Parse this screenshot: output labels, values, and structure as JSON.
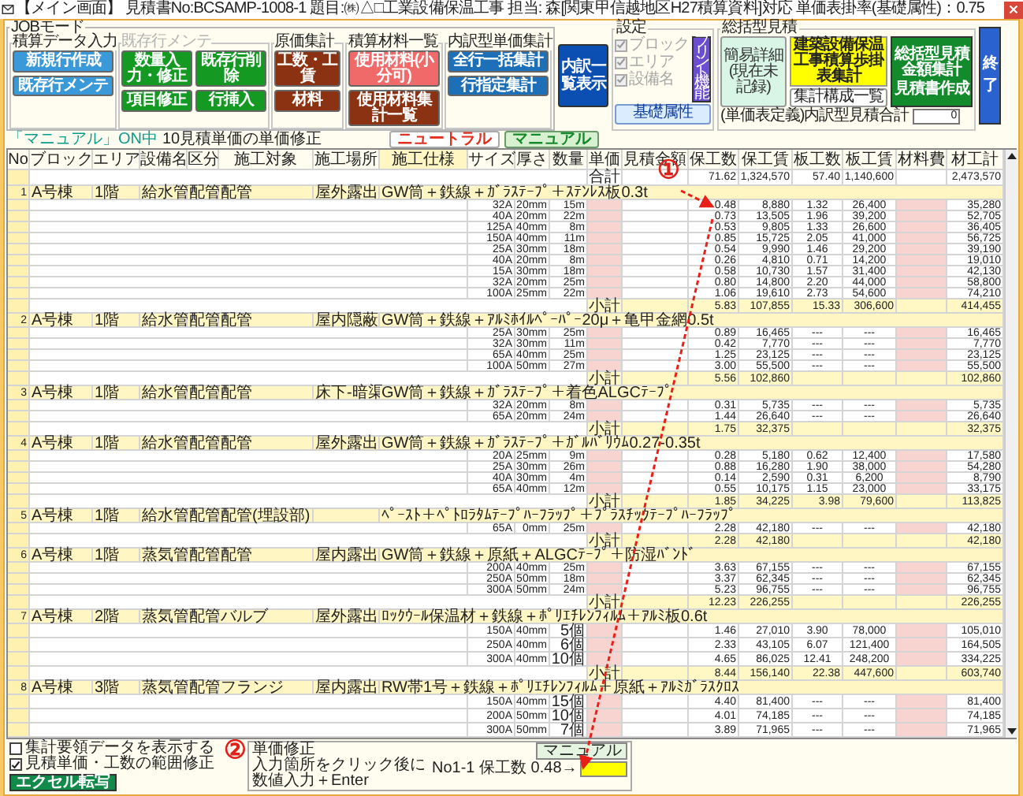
{
  "window": {
    "title": "【メイン画面】 見積書No:BCSAMP-1008-1 題目:㈱△□工業設備保温工事 担当: 森[関東甲信越地区H27積算資料]対応 単価表掛率(基礎属性)：0.75"
  },
  "toolbar": {
    "job_mode_label": "JOBモード",
    "groups": [
      {
        "label": "積算データ入力",
        "disabled": false,
        "buttons": [
          {
            "label": "新規行作成",
            "color": "#3a9ad9"
          },
          {
            "label": "既存行メンテ",
            "color": "#3a9ad9"
          }
        ]
      },
      {
        "label": "既存行メンテ",
        "disabled": true,
        "buttons": [
          {
            "label": "数量入力・修正",
            "color": "#149a22"
          },
          {
            "label": "既存行削除",
            "color": "#149a22"
          },
          {
            "label": "項目修正",
            "color": "#149a22"
          },
          {
            "label": "行挿入",
            "color": "#149a22"
          }
        ]
      },
      {
        "label": "原価集計",
        "disabled": false,
        "buttons": [
          {
            "label": "工数・工賃",
            "color": "#8a3212"
          },
          {
            "label": "材料",
            "color": "#8a3212"
          }
        ]
      },
      {
        "label": "積算材料一覧",
        "disabled": false,
        "buttons": [
          {
            "label": "使用材料(小分可)",
            "color": "#f06a6a"
          },
          {
            "label": "使用材料集計一覧",
            "color": "#8a3212"
          }
        ]
      },
      {
        "label": "内訳型単価集計",
        "disabled": false,
        "buttons": [
          {
            "label": "全行一括集計",
            "color": "#1d6fb8"
          },
          {
            "label": "行指定集計",
            "color": "#1d6fb8"
          }
        ]
      }
    ],
    "list_button": {
      "label": "内訳一覧表示",
      "color": "#0b4fb2"
    },
    "settings": {
      "label": "設定",
      "options": [
        {
          "label": "ブロック",
          "checked": true,
          "disabled": true
        },
        {
          "label": "エリア",
          "checked": true,
          "disabled": true
        },
        {
          "label": "設備名",
          "checked": true,
          "disabled": true
        }
      ],
      "print_button": "プリント機能",
      "base_button": "基礎属性"
    },
    "summary": {
      "label": "総括型見積",
      "simple_button": "簡易詳細(現在未記録)",
      "tally_button": "建築設備保温工事積算歩掛表集計",
      "structure_button": "集計構成一覧",
      "estimate_button": {
        "label": "総括型見積金額集計",
        "sublabel": "見積書作成"
      },
      "total_label": "(単価表定義)内訳型見積合計",
      "total_value": "0"
    },
    "exit_button": "終了"
  },
  "mode_bar": {
    "mode": "「マニュアル」ON中",
    "note": "10見積単価の単価修正",
    "buttons": [
      {
        "label": "ニュートラル",
        "selected": false
      },
      {
        "label": "マニュアル",
        "selected": true
      }
    ]
  },
  "table": {
    "callout": "①",
    "columns": [
      "No",
      "ブロック",
      "エリア",
      "設備名",
      "区分",
      "施工対象",
      "施工場所",
      "施工仕様",
      "サイズ",
      "厚さ",
      "数量",
      "単価",
      "見積金額",
      "保工数",
      "保工賃",
      "板工数",
      "板工賃",
      "材料費",
      "材工計"
    ],
    "rows": [
      {
        "kind": "total",
        "label": "合計",
        "labor_hours": "71.62",
        "labor_cost": "1,324,570",
        "sheet_hours": "57.40",
        "sheet_cost": "1,140,600",
        "total": "2,473,570"
      },
      {
        "kind": "section",
        "no": "1",
        "block": "A号棟",
        "area": "1階",
        "equipment": "給水管",
        "category": "配管",
        "target": "配管",
        "place": "屋外露出",
        "spec": "GW筒＋鉄線＋ｶﾞﾗｽﾃｰﾌﾟ＋ｽﾃﾝﾚｽ板0.3t"
      },
      {
        "kind": "item",
        "size": "32A",
        "thickness": "20mm",
        "qty": "15m",
        "labor_hours": "0.48",
        "labor_cost": "8,880",
        "sheet_hours": "1.32",
        "sheet_cost": "26,400",
        "total": "35,280"
      },
      {
        "kind": "item",
        "size": "40A",
        "thickness": "20mm",
        "qty": "22m",
        "labor_hours": "0.73",
        "labor_cost": "13,505",
        "sheet_hours": "1.96",
        "sheet_cost": "39,200",
        "total": "52,705"
      },
      {
        "kind": "item",
        "size": "125A",
        "thickness": "40mm",
        "qty": "8m",
        "labor_hours": "0.53",
        "labor_cost": "9,805",
        "sheet_hours": "1.33",
        "sheet_cost": "26,600",
        "total": "36,405"
      },
      {
        "kind": "item",
        "size": "150A",
        "thickness": "40mm",
        "qty": "11m",
        "labor_hours": "0.85",
        "labor_cost": "15,725",
        "sheet_hours": "2.05",
        "sheet_cost": "41,000",
        "total": "56,725"
      },
      {
        "kind": "item",
        "size": "25A",
        "thickness": "30mm",
        "qty": "18m",
        "labor_hours": "0.54",
        "labor_cost": "9,990",
        "sheet_hours": "1.46",
        "sheet_cost": "29,200",
        "total": "39,190"
      },
      {
        "kind": "item",
        "size": "40A",
        "thickness": "20mm",
        "qty": "8m",
        "labor_hours": "0.26",
        "labor_cost": "4,810",
        "sheet_hours": "0.71",
        "sheet_cost": "14,200",
        "total": "19,010"
      },
      {
        "kind": "item",
        "size": "15A",
        "thickness": "30mm",
        "qty": "18m",
        "labor_hours": "0.58",
        "labor_cost": "10,730",
        "sheet_hours": "1.57",
        "sheet_cost": "31,400",
        "total": "42,130"
      },
      {
        "kind": "item",
        "size": "32A",
        "thickness": "20mm",
        "qty": "25m",
        "labor_hours": "0.80",
        "labor_cost": "14,800",
        "sheet_hours": "2.20",
        "sheet_cost": "44,000",
        "total": "58,800"
      },
      {
        "kind": "item",
        "size": "100A",
        "thickness": "25mm",
        "qty": "22m",
        "labor_hours": "1.06",
        "labor_cost": "19,610",
        "sheet_hours": "2.73",
        "sheet_cost": "54,600",
        "total": "74,210"
      },
      {
        "kind": "subtotal",
        "label": "小計",
        "labor_hours": "5.83",
        "labor_cost": "107,855",
        "sheet_hours": "15.33",
        "sheet_cost": "306,600",
        "total": "414,455"
      },
      {
        "kind": "section",
        "no": "2",
        "block": "A号棟",
        "area": "1階",
        "equipment": "給水管",
        "category": "配管",
        "target": "配管",
        "place": "屋内隠蔽",
        "spec": "GW筒＋鉄線＋ｱﾙﾐﾎｲﾙﾍﾟｰﾊﾟｰ20μ＋亀甲金網0.5t"
      },
      {
        "kind": "item",
        "size": "25A",
        "thickness": "30mm",
        "qty": "25m",
        "labor_hours": "0.89",
        "labor_cost": "16,465",
        "sheet_hours": "---",
        "sheet_cost": "---",
        "total": "16,465"
      },
      {
        "kind": "item",
        "size": "32A",
        "thickness": "30mm",
        "qty": "11m",
        "labor_hours": "0.42",
        "labor_cost": "7,770",
        "sheet_hours": "---",
        "sheet_cost": "---",
        "total": "7,770"
      },
      {
        "kind": "item",
        "size": "65A",
        "thickness": "40mm",
        "qty": "25m",
        "labor_hours": "1.25",
        "labor_cost": "23,125",
        "sheet_hours": "---",
        "sheet_cost": "---",
        "total": "23,125"
      },
      {
        "kind": "item",
        "size": "100A",
        "thickness": "50mm",
        "qty": "27m",
        "labor_hours": "3.00",
        "labor_cost": "55,500",
        "sheet_hours": "---",
        "sheet_cost": "---",
        "total": "55,500"
      },
      {
        "kind": "subtotal",
        "label": "小計",
        "labor_hours": "5.56",
        "labor_cost": "102,860",
        "total": "102,860"
      },
      {
        "kind": "section",
        "no": "3",
        "block": "A号棟",
        "area": "1階",
        "equipment": "給水管",
        "category": "配管",
        "target": "配管",
        "place": "床下-暗渠",
        "spec": "GW筒＋鉄線＋ｶﾞﾗｽﾃｰﾌﾟ＋着色ALGCﾃｰﾌﾟ"
      },
      {
        "kind": "item",
        "size": "32A",
        "thickness": "20mm",
        "qty": "8m",
        "labor_hours": "0.31",
        "labor_cost": "5,735",
        "sheet_hours": "---",
        "sheet_cost": "---",
        "total": "5,735"
      },
      {
        "kind": "item",
        "size": "65A",
        "thickness": "20mm",
        "qty": "24m",
        "labor_hours": "1.44",
        "labor_cost": "26,640",
        "sheet_hours": "---",
        "sheet_cost": "---",
        "total": "26,640"
      },
      {
        "kind": "subtotal",
        "label": "小計",
        "labor_hours": "1.75",
        "labor_cost": "32,375",
        "total": "32,375"
      },
      {
        "kind": "section",
        "no": "4",
        "block": "A号棟",
        "area": "1階",
        "equipment": "給水管",
        "category": "配管",
        "target": "配管",
        "place": "屋外露出",
        "spec": "GW筒＋鉄線＋ｶﾞﾗｽﾃｰﾌﾟ＋ｶﾞﾙﾊﾞﾘｳﾑ0.27-0.35t"
      },
      {
        "kind": "item",
        "size": "20A",
        "thickness": "25mm",
        "qty": "9m",
        "labor_hours": "0.28",
        "labor_cost": "5,180",
        "sheet_hours": "0.62",
        "sheet_cost": "12,400",
        "total": "17,580"
      },
      {
        "kind": "item",
        "size": "25A",
        "thickness": "30mm",
        "qty": "26m",
        "labor_hours": "0.88",
        "labor_cost": "16,280",
        "sheet_hours": "1.90",
        "sheet_cost": "38,000",
        "total": "54,280"
      },
      {
        "kind": "item",
        "size": "40A",
        "thickness": "30mm",
        "qty": "4m",
        "labor_hours": "0.14",
        "labor_cost": "2,590",
        "sheet_hours": "0.31",
        "sheet_cost": "6,200",
        "total": "8,790"
      },
      {
        "kind": "item",
        "size": "65A",
        "thickness": "40mm",
        "qty": "12m",
        "labor_hours": "0.55",
        "labor_cost": "10,175",
        "sheet_hours": "1.15",
        "sheet_cost": "23,000",
        "total": "33,175"
      },
      {
        "kind": "subtotal",
        "label": "小計",
        "labor_hours": "1.85",
        "labor_cost": "34,225",
        "sheet_hours": "3.98",
        "sheet_cost": "79,600",
        "total": "113,825"
      },
      {
        "kind": "section",
        "no": "5",
        "block": "A号棟",
        "area": "1階",
        "equipment": "給水管",
        "category": "配管",
        "target": "配管(埋設部)",
        "spec": "ﾍﾟｰｽﾄ＋ﾍﾟﾄﾛﾗﾀﾑﾃｰﾌﾟﾊｰﾌﾗｯﾌﾟ＋ﾌﾟﾗｽﾁｯｸﾃｰﾌﾟﾊｰﾌﾗｯﾌﾟ"
      },
      {
        "kind": "item",
        "size": "65A",
        "thickness": "0mm",
        "qty": "25m",
        "labor_hours": "2.28",
        "labor_cost": "42,180",
        "sheet_hours": "---",
        "sheet_cost": "---",
        "total": "42,180"
      },
      {
        "kind": "subtotal",
        "label": "小計",
        "labor_hours": "2.28",
        "labor_cost": "42,180",
        "total": "42,180"
      },
      {
        "kind": "section",
        "no": "6",
        "block": "A号棟",
        "area": "1階",
        "equipment": "蒸気管",
        "category": "配管",
        "target": "配管",
        "place": "屋内露出",
        "spec": "GW筒＋鉄線＋原紙＋ALGCﾃｰﾌﾟ＋防湿ﾊﾞﾝﾄﾞ"
      },
      {
        "kind": "item",
        "size": "200A",
        "thickness": "40mm",
        "qty": "25m",
        "labor_hours": "3.63",
        "labor_cost": "67,155",
        "sheet_hours": "---",
        "sheet_cost": "---",
        "total": "67,155"
      },
      {
        "kind": "item",
        "size": "250A",
        "thickness": "50mm",
        "qty": "18m",
        "labor_hours": "3.37",
        "labor_cost": "62,345",
        "sheet_hours": "---",
        "sheet_cost": "---",
        "total": "62,345"
      },
      {
        "kind": "item",
        "size": "300A",
        "thickness": "50mm",
        "qty": "24m",
        "labor_hours": "5.23",
        "labor_cost": "96,755",
        "sheet_hours": "---",
        "sheet_cost": "---",
        "total": "96,755"
      },
      {
        "kind": "subtotal",
        "label": "小計",
        "labor_hours": "12.23",
        "labor_cost": "226,255",
        "total": "226,255"
      },
      {
        "kind": "section",
        "no": "7",
        "block": "A号棟",
        "area": "2階",
        "equipment": "蒸気管",
        "category": "配管",
        "target": "バルブ",
        "place": "屋外露出",
        "spec": "ﾛｯｸｳｰﾙ保温材＋鉄線＋ﾎﾟﾘｴﾁﾚﾝﾌｨﾙﾑ＋ｱﾙﾐ板0.6t"
      },
      {
        "kind": "item",
        "size": "150A",
        "thickness": "40mm",
        "qty": "5個",
        "labor_hours": "1.46",
        "labor_cost": "27,010",
        "sheet_hours": "3.90",
        "sheet_cost": "78,000",
        "total": "105,010"
      },
      {
        "kind": "item",
        "size": "250A",
        "thickness": "40mm",
        "qty": "6個",
        "labor_hours": "2.33",
        "labor_cost": "43,105",
        "sheet_hours": "6.07",
        "sheet_cost": "121,400",
        "total": "164,505"
      },
      {
        "kind": "item",
        "size": "300A",
        "thickness": "40mm",
        "qty": "10個",
        "labor_hours": "4.65",
        "labor_cost": "86,025",
        "sheet_hours": "12.41",
        "sheet_cost": "248,200",
        "total": "334,225"
      },
      {
        "kind": "subtotal",
        "label": "小計",
        "labor_hours": "8.44",
        "labor_cost": "156,140",
        "sheet_hours": "22.38",
        "sheet_cost": "447,600",
        "total": "603,740"
      },
      {
        "kind": "section",
        "no": "8",
        "block": "A号棟",
        "area": "3階",
        "equipment": "蒸気管",
        "category": "配管",
        "target": "フランジ",
        "place": "屋内露出",
        "spec": "RW帯1号＋鉄線＋ﾎﾟﾘｴﾁﾚﾝﾌｨﾙﾑ＋原紙＋ｱﾙﾐｶﾞﾗｽｸﾛｽ"
      },
      {
        "kind": "item",
        "size": "150A",
        "thickness": "40mm",
        "qty": "15個",
        "labor_hours": "4.40",
        "labor_cost": "81,400",
        "sheet_hours": "---",
        "sheet_cost": "---",
        "total": "81,400"
      },
      {
        "kind": "item",
        "size": "200A",
        "thickness": "50mm",
        "qty": "10個",
        "labor_hours": "4.01",
        "labor_cost": "74,185",
        "sheet_hours": "---",
        "sheet_cost": "---",
        "total": "74,185"
      },
      {
        "kind": "item",
        "size": "300A",
        "thickness": "50mm",
        "qty": "7個",
        "labor_hours": "3.89",
        "labor_cost": "71,965",
        "sheet_hours": "---",
        "sheet_cost": "---",
        "total": "71,965"
      }
    ]
  },
  "options": [
    {
      "label": "集計要領データを表示する",
      "checked": false
    },
    {
      "label": "見積単価・工数の範囲修正",
      "checked": true
    }
  ],
  "excel_button": "エクセル転写",
  "price_fix": {
    "callout": "②",
    "label": "単価修正",
    "lines": [
      "入力箇所をクリック後に",
      "数値入力＋Enter"
    ],
    "target": "No1-1 保工数 0.48→",
    "button": "マニュアル"
  }
}
